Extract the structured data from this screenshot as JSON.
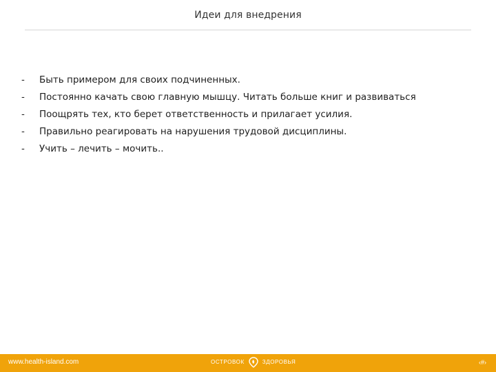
{
  "slide": {
    "title": "Идеи для внедрения",
    "bullets": [
      {
        "marker": "-",
        "text": "Быть примером для своих подчиненных."
      },
      {
        "marker": "-",
        "text": "Постоянно качать свою главную мышцу. Читать больше книг и развиваться"
      },
      {
        "marker": "-",
        "text": "Поощрять тех, кто берет ответственность и прилагает усилия."
      },
      {
        "marker": "-",
        "text": "Правильно реагировать на нарушения трудовой дисциплины."
      },
      {
        "marker": "-",
        "text": "Учить – лечить – мочить.."
      }
    ]
  },
  "footer": {
    "url": "www.health-island.com",
    "brand_left": "ОСТРОВОК",
    "brand_right": "ЗДОРОВЬЯ",
    "brand_icon": "pin-leaf-icon",
    "page_marker": "‹#›",
    "color": "#f0a30a"
  }
}
